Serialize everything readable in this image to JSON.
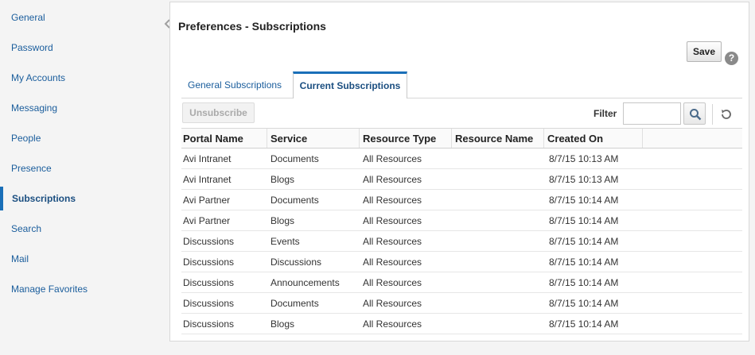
{
  "sidebar": {
    "items": [
      {
        "label": "General"
      },
      {
        "label": "Password"
      },
      {
        "label": "My Accounts"
      },
      {
        "label": "Messaging"
      },
      {
        "label": "People"
      },
      {
        "label": "Presence"
      },
      {
        "label": "Subscriptions",
        "active": true
      },
      {
        "label": "Search"
      },
      {
        "label": "Mail"
      },
      {
        "label": "Manage Favorites"
      }
    ]
  },
  "panel": {
    "title": "Preferences - Subscriptions",
    "save_label": "Save",
    "help_glyph": "?"
  },
  "tabs": [
    {
      "label": "General Subscriptions",
      "selected": false
    },
    {
      "label": "Current Subscriptions",
      "selected": true
    }
  ],
  "toolbar": {
    "unsubscribe_label": "Unsubscribe",
    "filter_label": "Filter",
    "filter_value": ""
  },
  "table": {
    "columns": [
      "Portal Name",
      "Service",
      "Resource Type",
      "Resource Name",
      "Created On"
    ],
    "rows": [
      [
        "Avi Intranet",
        "Documents",
        "All Resources",
        "",
        "8/7/15 10:13 AM"
      ],
      [
        "Avi Intranet",
        "Blogs",
        "All Resources",
        "",
        "8/7/15 10:13 AM"
      ],
      [
        "Avi Partner",
        "Documents",
        "All Resources",
        "",
        "8/7/15 10:14 AM"
      ],
      [
        "Avi Partner",
        "Blogs",
        "All Resources",
        "",
        "8/7/15 10:14 AM"
      ],
      [
        "Discussions",
        "Events",
        "All Resources",
        "",
        "8/7/15 10:14 AM"
      ],
      [
        "Discussions",
        "Discussions",
        "All Resources",
        "",
        "8/7/15 10:14 AM"
      ],
      [
        "Discussions",
        "Announcements",
        "All Resources",
        "",
        "8/7/15 10:14 AM"
      ],
      [
        "Discussions",
        "Documents",
        "All Resources",
        "",
        "8/7/15 10:14 AM"
      ],
      [
        "Discussions",
        "Blogs",
        "All Resources",
        "",
        "8/7/15 10:14 AM"
      ]
    ]
  },
  "colors": {
    "accent": "#1a6fb8",
    "link": "#1a5d9c"
  },
  "icons": {
    "collapse": "chevron-left-icon",
    "search": "search-icon",
    "refresh": "refresh-icon",
    "help": "help-icon"
  }
}
